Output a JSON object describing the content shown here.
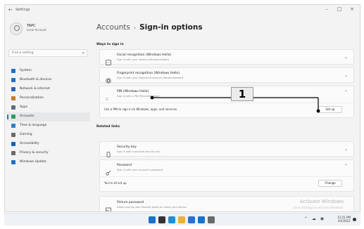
{
  "window": {
    "app_title": "Settings",
    "back_glyph": "←",
    "controls": {
      "minimize": "–",
      "maximize": "□",
      "close": "×"
    }
  },
  "user": {
    "name": "TAPC",
    "role": "Local Account"
  },
  "search": {
    "placeholder": "Find a setting",
    "icon": "search-icon"
  },
  "nav": [
    {
      "label": "System",
      "icon": "system-icon",
      "color": "#1a73c7",
      "active": false
    },
    {
      "label": "Bluetooth & devices",
      "icon": "bluetooth-icon",
      "color": "#1a73c7",
      "active": false
    },
    {
      "label": "Network & internet",
      "icon": "network-icon",
      "color": "#2f5fb7",
      "active": false
    },
    {
      "label": "Personalization",
      "icon": "brush-icon",
      "color": "#c7782a",
      "active": false
    },
    {
      "label": "Apps",
      "icon": "apps-icon",
      "color": "#5c6b7f",
      "active": false
    },
    {
      "label": "Accounts",
      "icon": "accounts-icon",
      "color": "#2f9e55",
      "active": true
    },
    {
      "label": "Time & language",
      "icon": "time-icon",
      "color": "#2f7fc7",
      "active": false
    },
    {
      "label": "Gaming",
      "icon": "gaming-icon",
      "color": "#6a6a6a",
      "active": false
    },
    {
      "label": "Accessibility",
      "icon": "accessibility-icon",
      "color": "#1a5fb4",
      "active": false
    },
    {
      "label": "Privacy & security",
      "icon": "shield-icon",
      "color": "#6a6a6a",
      "active": false
    },
    {
      "label": "Windows Update",
      "icon": "update-icon",
      "color": "#1a73c7",
      "active": false
    }
  ],
  "breadcrumb": {
    "parent": "Accounts",
    "separator": "›",
    "current": "Sign-in options"
  },
  "ways_label": "Ways to sign in",
  "options": [
    {
      "title": "Facial recognition (Windows Hello)",
      "subtitle": "Sign in with your camera (Recommended)",
      "icon": "face-icon"
    },
    {
      "title": "Fingerprint recognition (Windows Hello)",
      "subtitle": "Sign in with your fingerprint scanner (Recommended)",
      "icon": "fingerprint-icon"
    },
    {
      "title": "PIN (Windows Hello)",
      "subtitle": "Sign in with a PIN (Recommended)",
      "icon": "pin-icon"
    }
  ],
  "pin_expanded": {
    "text": "Use a PIN to sign in to Windows, apps, and services",
    "button": "Set up"
  },
  "related_label": "Related links",
  "related": [
    {
      "title": "Security key",
      "subtitle": "Sign in with a physical security key",
      "icon": "key-icon"
    },
    {
      "title": "Password",
      "subtitle": "Sign in with your account's password",
      "icon": "password-icon"
    }
  ],
  "password_expanded": {
    "text": "You're all set up",
    "button": "Change"
  },
  "picture_password": {
    "title": "Picture password",
    "subtitle": "Swipe and tap your favorite photo to unlock your device",
    "icon": "picture-icon"
  },
  "watermark": {
    "line1": "Activate Windows",
    "line2": "Go to Settings to activate Windows."
  },
  "callout": {
    "number": "1"
  },
  "taskbar": {
    "icons": [
      "windows-icon",
      "search-icon",
      "edge-icon",
      "explorer-icon",
      "store-icon",
      "mail-icon",
      "settings-icon"
    ],
    "icon_colors": [
      "#1a73c7",
      "#333333",
      "#1f8fd8",
      "#e8b431",
      "#2c6fd1",
      "#1a73c7",
      "#6a6a6a"
    ],
    "tray_time": "12:21 PM",
    "tray_date": "4/3/2021"
  }
}
